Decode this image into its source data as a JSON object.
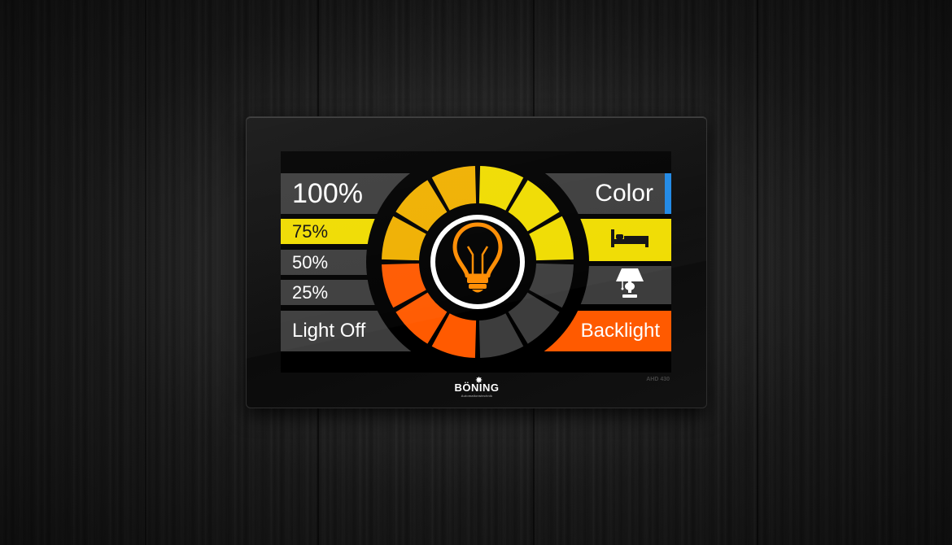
{
  "panel": {
    "model": "AHD 430",
    "brand": "BÖNING",
    "brand_tagline": "Automationstechnik"
  },
  "levels": [
    {
      "label": "100%",
      "active": false
    },
    {
      "label": "75%",
      "active": true
    },
    {
      "label": "50%",
      "active": false
    },
    {
      "label": "25%",
      "active": false
    },
    {
      "label": "Light Off",
      "active": false
    }
  ],
  "modes": [
    {
      "label": "Color",
      "icon": ""
    },
    {
      "label": "",
      "icon": "bed-icon"
    },
    {
      "label": "",
      "icon": "table-lamp-icon"
    },
    {
      "label": "Backlight",
      "icon": ""
    }
  ],
  "dial": {
    "center_icon": "light-bulb-icon",
    "segments_lit": 8,
    "segments_total": 12
  },
  "colors": {
    "yellow": "#f0dc00",
    "amber": "#f0b000",
    "orange": "#ff5a00",
    "gray": "#3d3d3d",
    "accent_blue": "#1e88e5",
    "bulb": "#ff8c00"
  }
}
